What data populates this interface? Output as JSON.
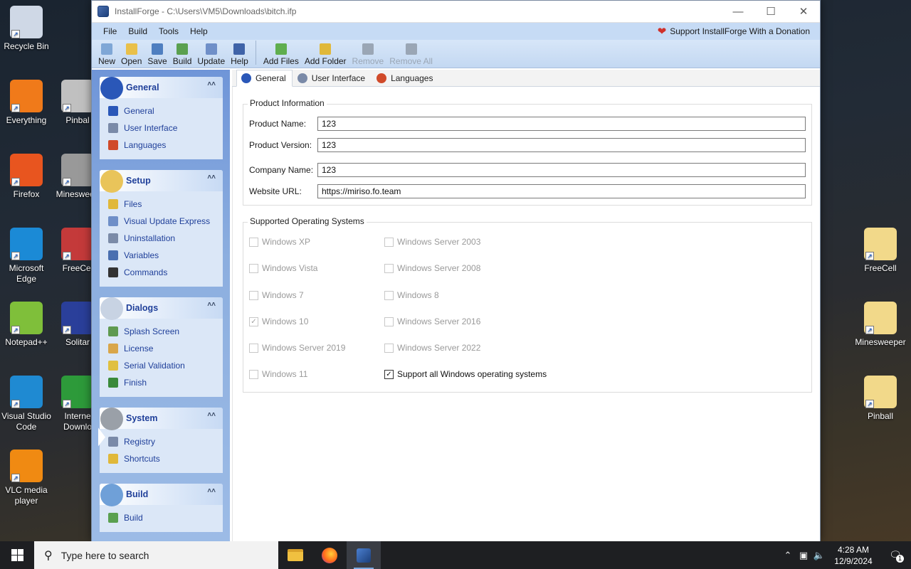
{
  "desktop": {
    "icons_left": [
      {
        "label": "Recycle Bin",
        "icon": "recycle-bin-icon",
        "color": "#cfd8e6"
      },
      {
        "label": "Everything",
        "icon": "everything-icon",
        "color": "#f07a1a"
      },
      {
        "label": "Firefox",
        "icon": "firefox-icon",
        "color": "#e8551f"
      },
      {
        "label": "Microsoft Edge",
        "icon": "edge-icon",
        "color": "#1b8ad6"
      },
      {
        "label": "Notepad++",
        "icon": "notepadpp-icon",
        "color": "#7fbf3a"
      },
      {
        "label": "Visual Studio Code",
        "icon": "vscode-icon",
        "color": "#1f8ad2"
      },
      {
        "label": "VLC media player",
        "icon": "vlc-icon",
        "color": "#f08a12"
      }
    ],
    "icons_second": [
      {
        "label": "Pinbal",
        "icon": "pinball-icon",
        "color": "#c0c0c0"
      },
      {
        "label": "Minesweep",
        "icon": "minesweeper-icon",
        "color": "#999999"
      },
      {
        "label": "FreeCel",
        "icon": "freecell-icon",
        "color": "#c43a3a"
      },
      {
        "label": "Solitar",
        "icon": "solitaire-icon",
        "color": "#2a3f9a"
      },
      {
        "label": "Interne Downlo",
        "icon": "idm-icon",
        "color": "#2d9a3a"
      }
    ],
    "icons_right": [
      {
        "label": "FreeCell",
        "icon": "folder-icon",
        "color": "#f2d98a"
      },
      {
        "label": "Minesweeper",
        "icon": "folder-icon",
        "color": "#f2d98a"
      },
      {
        "label": "Pinball",
        "icon": "folder-icon",
        "color": "#f2d98a"
      }
    ]
  },
  "window": {
    "title": "InstallForge - C:\\Users\\VM5\\Downloads\\bitch.ifp",
    "menu": [
      "File",
      "Build",
      "Tools",
      "Help"
    ],
    "donate": "Support InstallForge With a Donation",
    "toolbar_group1": [
      {
        "label": "New",
        "icon": "new-file-icon",
        "color": "#7fa7d6"
      },
      {
        "label": "Open",
        "icon": "open-folder-icon",
        "color": "#e9c04a"
      },
      {
        "label": "Save",
        "icon": "save-icon",
        "color": "#4f7fc0"
      },
      {
        "label": "Build",
        "icon": "build-gear-icon",
        "color": "#5aa050"
      },
      {
        "label": "Update",
        "icon": "update-icon",
        "color": "#6f8fc8"
      },
      {
        "label": "Help",
        "icon": "help-book-icon",
        "color": "#3f63a8"
      }
    ],
    "toolbar_group2": [
      {
        "label": "Add Files",
        "icon": "add-files-icon",
        "color": "#5fae4e",
        "disabled": false
      },
      {
        "label": "Add Folder",
        "icon": "add-folder-icon",
        "color": "#e0b83a",
        "disabled": false
      },
      {
        "label": "Remove",
        "icon": "remove-icon",
        "color": "#9aa6b5",
        "disabled": true
      },
      {
        "label": "Remove All",
        "icon": "remove-all-icon",
        "color": "#9aa6b5",
        "disabled": true
      }
    ]
  },
  "sidebar": {
    "panels": [
      {
        "title": "General",
        "icon": "info-icon",
        "color": "#2a57b8",
        "items": [
          {
            "label": "General",
            "icon": "info-small-icon",
            "color": "#2a57b8"
          },
          {
            "label": "User Interface",
            "icon": "window-icon",
            "color": "#7a8aa8"
          },
          {
            "label": "Languages",
            "icon": "languages-icon",
            "color": "#d04a2a"
          }
        ]
      },
      {
        "title": "Setup",
        "icon": "setup-folder-icon",
        "color": "#e9c45a",
        "items": [
          {
            "label": "Files",
            "icon": "files-icon",
            "color": "#e0b83a"
          },
          {
            "label": "Visual Update Express",
            "icon": "update-small-icon",
            "color": "#6f8fc8"
          },
          {
            "label": "Uninstallation",
            "icon": "uninstall-icon",
            "color": "#7b8ba8"
          },
          {
            "label": "Variables",
            "icon": "code-icon",
            "color": "#4a6fb0"
          },
          {
            "label": "Commands",
            "icon": "terminal-icon",
            "color": "#333333"
          }
        ]
      },
      {
        "title": "Dialogs",
        "icon": "dialogs-icon",
        "color": "#c8d3e3",
        "items": [
          {
            "label": "Splash Screen",
            "icon": "splash-icon",
            "color": "#5f9a50"
          },
          {
            "label": "License",
            "icon": "license-icon",
            "color": "#d9a64a"
          },
          {
            "label": "Serial Validation",
            "icon": "serial-icon",
            "color": "#e0c040"
          },
          {
            "label": "Finish",
            "icon": "finish-icon",
            "color": "#3a8a3a"
          }
        ]
      },
      {
        "title": "System",
        "icon": "system-gears-icon",
        "color": "#9aa0a8",
        "items": [
          {
            "label": "Registry",
            "icon": "registry-icon",
            "color": "#7a8aa8"
          },
          {
            "label": "Shortcuts",
            "icon": "shortcuts-icon",
            "color": "#e0b83a"
          }
        ]
      },
      {
        "title": "Build",
        "icon": "build-disc-icon",
        "color": "#6fa0d8",
        "items": [
          {
            "label": "Build",
            "icon": "build-small-icon",
            "color": "#5aa050"
          }
        ]
      }
    ]
  },
  "main": {
    "tabs": [
      {
        "label": "General",
        "icon": "info-tab-icon",
        "color": "#2a57b8",
        "active": true
      },
      {
        "label": "User Interface",
        "icon": "window-tab-icon",
        "color": "#7a8aa8",
        "active": false
      },
      {
        "label": "Languages",
        "icon": "languages-tab-icon",
        "color": "#d04a2a",
        "active": false
      }
    ],
    "product_info": {
      "title": "Product Information",
      "fields": [
        {
          "label": "Product Name:",
          "value": "123"
        },
        {
          "label": "Product Version:",
          "value": "123"
        },
        {
          "label": "Company Name:",
          "value": "123"
        },
        {
          "label": "Website URL:",
          "value": "https://miriso.fo.team"
        }
      ]
    },
    "supported_os": {
      "title": "Supported Operating Systems",
      "left": [
        {
          "label": "Windows XP",
          "checked": false
        },
        {
          "label": "Windows Vista",
          "checked": false
        },
        {
          "label": "Windows 7",
          "checked": false
        },
        {
          "label": "Windows 10",
          "checked": true
        },
        {
          "label": "Windows Server 2019",
          "checked": false
        },
        {
          "label": "Windows 11",
          "checked": false
        }
      ],
      "right": [
        {
          "label": "Windows Server 2003",
          "checked": false
        },
        {
          "label": "Windows Server 2008",
          "checked": false
        },
        {
          "label": "Windows 8",
          "checked": false
        },
        {
          "label": "Windows Server 2016",
          "checked": false
        },
        {
          "label": "Windows Server 2022",
          "checked": false
        }
      ],
      "support_all": {
        "label": "Support all Windows operating systems",
        "checked": true
      }
    }
  },
  "taskbar": {
    "search_placeholder": "Type here to search",
    "time": "4:28 AM",
    "date": "12/9/2024",
    "notification_count": "1"
  }
}
